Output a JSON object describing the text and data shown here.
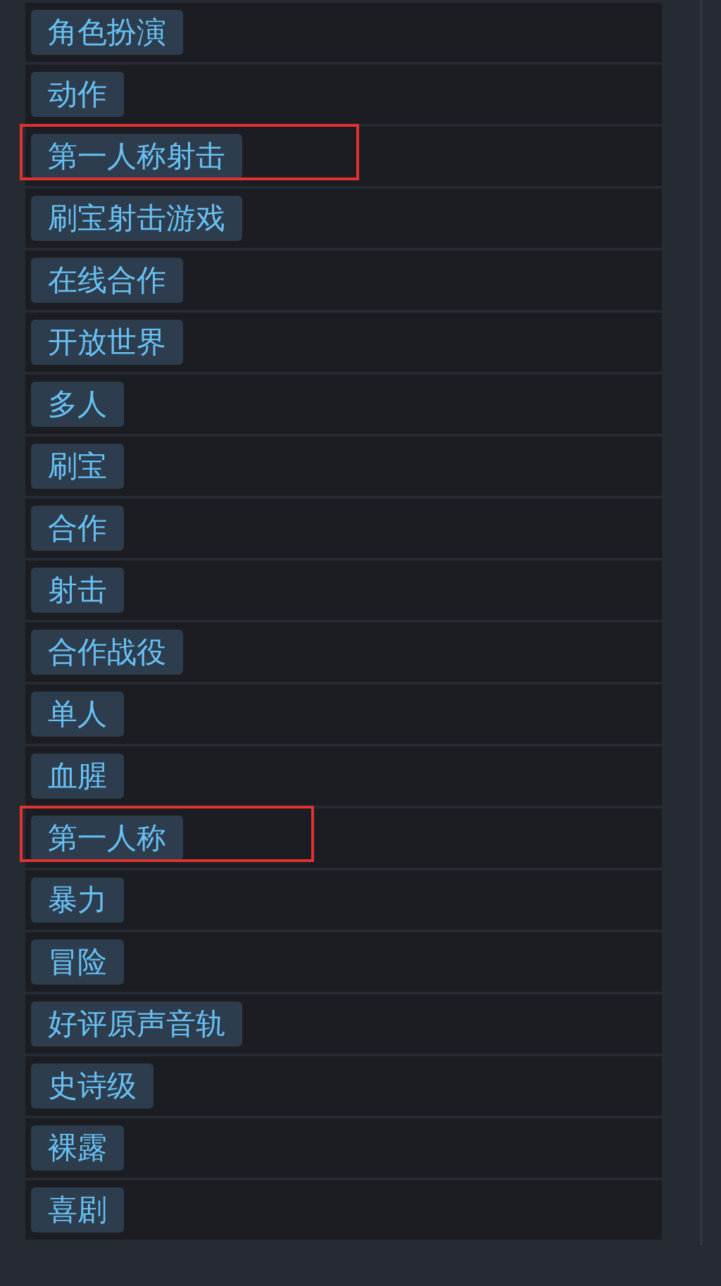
{
  "tags": [
    {
      "label": "角色扮演",
      "highlighted": false
    },
    {
      "label": "动作",
      "highlighted": false
    },
    {
      "label": "第一人称射击",
      "highlighted": true
    },
    {
      "label": "刷宝射击游戏",
      "highlighted": false
    },
    {
      "label": "在线合作",
      "highlighted": false
    },
    {
      "label": "开放世界",
      "highlighted": false
    },
    {
      "label": "多人",
      "highlighted": false
    },
    {
      "label": "刷宝",
      "highlighted": false
    },
    {
      "label": "合作",
      "highlighted": false
    },
    {
      "label": "射击",
      "highlighted": false
    },
    {
      "label": "合作战役",
      "highlighted": false
    },
    {
      "label": "单人",
      "highlighted": false
    },
    {
      "label": "血腥",
      "highlighted": false
    },
    {
      "label": "第一人称",
      "highlighted": true
    },
    {
      "label": "暴力",
      "highlighted": false
    },
    {
      "label": "冒险",
      "highlighted": false
    },
    {
      "label": "好评原声音轨",
      "highlighted": false
    },
    {
      "label": "史诗级",
      "highlighted": false
    },
    {
      "label": "裸露",
      "highlighted": false
    },
    {
      "label": "喜剧",
      "highlighted": false
    }
  ]
}
